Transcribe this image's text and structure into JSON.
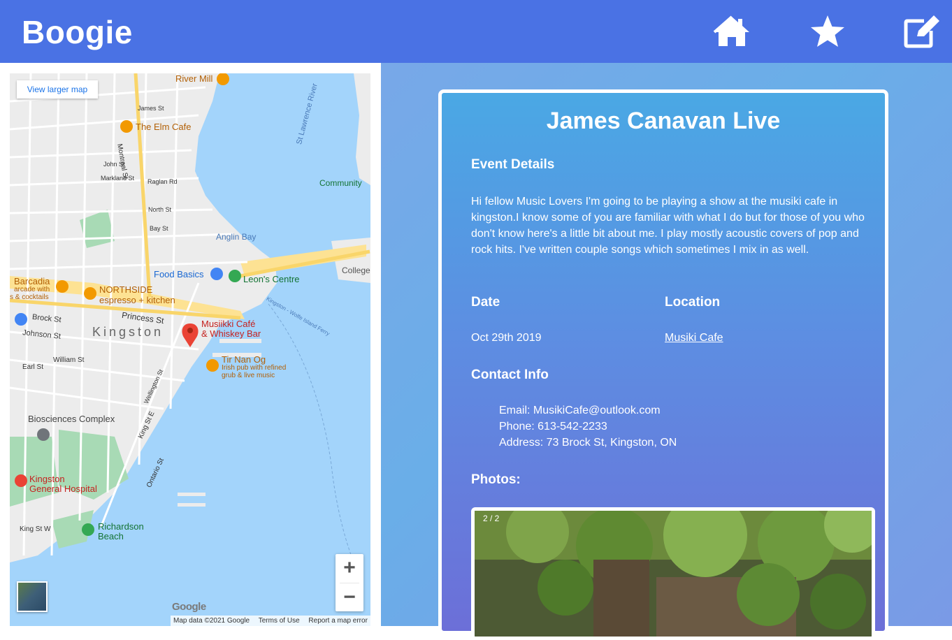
{
  "header": {
    "brand": "Boogie",
    "icons": [
      "home-icon",
      "star-icon",
      "edit-icon"
    ],
    "bg_color": "#4a72e4"
  },
  "map": {
    "view_larger": "View larger map",
    "labels": {
      "river_mill": "River Mill",
      "elm_cafe": "The Elm Cafe",
      "st_lawrence": "St Lawrence River",
      "community": "Community",
      "anglin_bay": "Anglin Bay",
      "food_basics": "Food Basics",
      "leons": "Leon's Centre",
      "college": "College",
      "barcadia": "Barcadia",
      "barcadia_sub1": "arcade with",
      "barcadia_sub2": "s & cocktails",
      "northside": "NORTHSIDE",
      "northside_sub": "espresso + kitchen",
      "princess_st": "Princess St",
      "brock_st": "Brock St",
      "johnson_st": "Johnson St",
      "kingston": "Kingston",
      "musiikki1": "Musiikki Café",
      "musiikki2": "& Whiskey Bar",
      "tir_nan_og": "Tir Nan Og",
      "tir_sub1": "Irish pub with refined",
      "tir_sub2": "grub & live music",
      "william_st": "William St",
      "earl_st": "Earl St",
      "biosciences": "Biosciences Complex",
      "kgh1": "Kingston",
      "kgh2": "General Hospital",
      "richardson1": "Richardson",
      "richardson2": "Beach",
      "king_st_w": "King St W",
      "king_st_e": "King St E",
      "ontario_st": "Ontario St",
      "wellington_st": "Wellington St",
      "montreal_st": "Montreal St",
      "bay_st": "Bay St",
      "north_st": "North St",
      "john_st": "John St",
      "james_st": "James St",
      "markland_st": "Markland St",
      "raglan_rd": "Raglan Rd",
      "ferry": "Kingston - Wolfe Island Ferry"
    },
    "zoom_in": "+",
    "zoom_out": "−",
    "google": "Google",
    "attribution": [
      "Map data ©2021 Google",
      "Terms of Use",
      "Report a map error"
    ]
  },
  "event": {
    "title": "James Canavan Live",
    "details_heading": "Event Details",
    "description": "Hi fellow Music Lovers I'm going to be playing a show at the musiki cafe in kingston.I know some of you are familiar with what I do but for those of you who don't know here's a little bit about me. I play mostly acoustic covers of pop and rock hits. I've written couple songs which sometimes I mix in as well.",
    "date_heading": "Date",
    "date_value": "Oct 29th 2019",
    "location_heading": "Location",
    "location_value": "Musiki Cafe",
    "contact_heading": "Contact Info",
    "email": "Email: MusikiCafe@outlook.com",
    "phone": "Phone: 613-542-2233",
    "address": "Address: 73 Brock St, Kingston, ON",
    "photos_heading": "Photos:",
    "photo_counter": "2 / 2"
  }
}
